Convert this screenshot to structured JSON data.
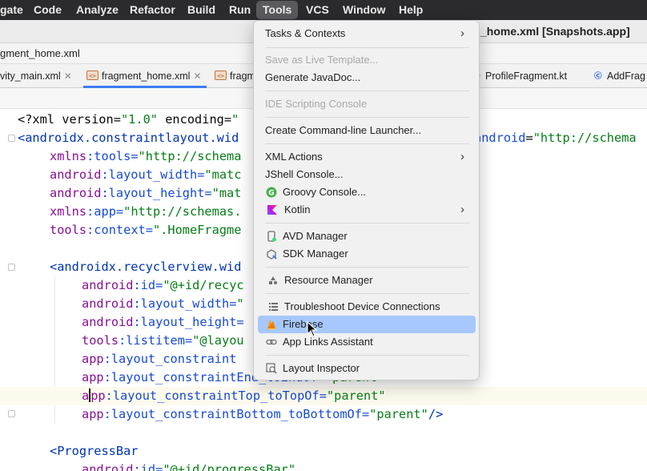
{
  "menubar": {
    "items": [
      "gate",
      "Code",
      "Analyze",
      "Refactor",
      "Build",
      "Run",
      "Tools",
      "VCS",
      "Window",
      "Help"
    ],
    "active": "Tools"
  },
  "window": {
    "title": "_home.xml [Snapshots.app]"
  },
  "breadcrumb": "gment_home.xml",
  "tabs": [
    {
      "label": "vity_main.xml"
    },
    {
      "label": "fragment_home.xml",
      "active": true
    },
    {
      "label": "fragm"
    },
    {
      "label": "ProfileFragment.kt"
    },
    {
      "label": "AddFrag"
    }
  ],
  "code": {
    "l1": {
      "a": "<?xml version=",
      "b": "\"1.0\"",
      "c": " encoding=",
      "d": "\""
    },
    "l2": {
      "a": "<androidx.constraintlayout.wid",
      "b": "android",
      "c": ":",
      "d": "=",
      "e": "\"http://schema"
    },
    "l3": {
      "a": "xmlns",
      "b": ":tools=",
      "c": "\"http://schema"
    },
    "l4": {
      "a": "android",
      "b": ":layout_width=",
      "c": "\"matc"
    },
    "l5": {
      "a": "android",
      "b": ":layout_height=",
      "c": "\"mat"
    },
    "l6": {
      "a": "xmlns",
      "b": ":app=",
      "c": "\"http://schemas."
    },
    "l7": {
      "a": "tools",
      "b": ":context=",
      "c": "\".HomeFragme"
    },
    "l8": {
      "a": "<androidx.recyclerview.wid"
    },
    "l9": {
      "a": "android",
      "b": ":id=",
      "c": "\"@+id/recyc"
    },
    "l10": {
      "a": "android",
      "b": ":layout_width=",
      "c": "\""
    },
    "l11": {
      "a": "android",
      "b": ":layout_height="
    },
    "l12": {
      "a": "tools",
      "b": ":listitem=",
      "c": "\"@layou"
    },
    "l13": {
      "a": "app",
      "b": ":layout_constraint"
    },
    "l14": {
      "a": "app",
      "b": ":layout_constraintEnd_toEndOf=",
      "c": "\"parent"
    },
    "l15": {
      "a": "a",
      "b": "pp",
      "c": ":layout_constraintTop_toTopOf=",
      "d": "\"parent\""
    },
    "l16": {
      "a": "app",
      "b": ":layout_constraintBottom_toBottomOf=",
      "c": "\"parent\"",
      "d": "/>"
    },
    "l17": {
      "a": "<ProgressBar"
    },
    "l18": {
      "a": "android",
      "b": ":id=",
      "c": "\"@+id/progressBar\""
    }
  },
  "tools_menu": {
    "items": [
      {
        "label": "Tasks & Contexts",
        "submenu": true
      },
      {
        "label": "Save as Live Template...",
        "disabled": true
      },
      {
        "label": "Generate JavaDoc..."
      },
      {
        "label": "IDE Scripting Console",
        "disabled": true
      },
      {
        "label": "Create Command-line Launcher..."
      },
      {
        "label": "XML Actions",
        "submenu": true
      },
      {
        "label": "JShell Console..."
      },
      {
        "label": "Groovy Console...",
        "icon": "groovy-icon"
      },
      {
        "label": "Kotlin",
        "icon": "kotlin-icon",
        "submenu": true
      },
      {
        "label": "AVD Manager",
        "icon": "avd-manager-icon"
      },
      {
        "label": "SDK Manager",
        "icon": "sdk-manager-icon"
      },
      {
        "label": "Resource Manager",
        "icon": "resource-manager-icon"
      },
      {
        "label": "Troubleshoot Device Connections",
        "icon": "list-icon"
      },
      {
        "label": "Firebase",
        "icon": "firebase-icon",
        "selected": true
      },
      {
        "label": "App Links Assistant",
        "icon": "link-icon"
      },
      {
        "label": "Layout Inspector",
        "icon": "layout-inspector-icon"
      }
    ],
    "submenu_arrow": "›"
  },
  "colors": {
    "accent": "#3d7cf5",
    "menu_selection": "#a6c8ff",
    "xml_tag": "#0033b3",
    "xml_attr": "#174ad4",
    "xml_namespace": "#871094",
    "xml_string": "#067d17"
  }
}
